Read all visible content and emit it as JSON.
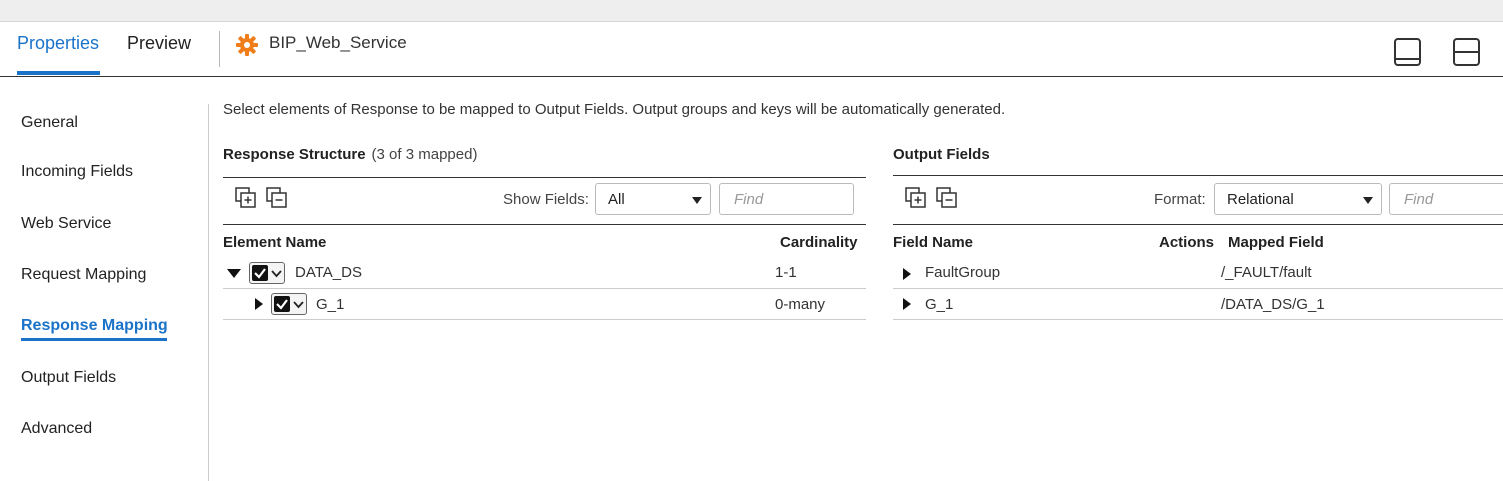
{
  "header": {
    "tabs": [
      {
        "label": "Properties",
        "active": true
      },
      {
        "label": "Preview",
        "active": false
      }
    ],
    "object_title": "BIP_Web_Service",
    "accent_color": "#1a73c9",
    "gear_color": "#f07d1a"
  },
  "nav": {
    "items": [
      {
        "label": "General",
        "active": false
      },
      {
        "label": "Incoming Fields",
        "active": false
      },
      {
        "label": "Web Service",
        "active": false
      },
      {
        "label": "Request Mapping",
        "active": false
      },
      {
        "label": "Response Mapping",
        "active": true
      },
      {
        "label": "Output Fields",
        "active": false
      },
      {
        "label": "Advanced",
        "active": false
      }
    ]
  },
  "description": "Select elements of Response to be mapped to Output Fields. Output groups and keys will be automatically generated.",
  "response": {
    "title": "Response Structure",
    "mapped_status": "(3 of 3 mapped)",
    "show_fields_label": "Show Fields:",
    "show_fields_value": "All",
    "find_placeholder": "Find",
    "columns": {
      "element": "Element Name",
      "cardinality": "Cardinality"
    },
    "rows": [
      {
        "name": "DATA_DS",
        "cardinality": "1-1",
        "expanded": true,
        "checked": true
      },
      {
        "name": "G_1",
        "cardinality": "0-many",
        "expanded": false,
        "checked": true
      }
    ]
  },
  "output": {
    "title": "Output Fields",
    "format_label": "Format:",
    "format_value": "Relational",
    "find_placeholder": "Find",
    "columns": {
      "field": "Field Name",
      "actions": "Actions",
      "mapped": "Mapped Field"
    },
    "rows": [
      {
        "name": "FaultGroup",
        "mapped": "/_FAULT/fault"
      },
      {
        "name": "G_1",
        "mapped": "/DATA_DS/G_1"
      }
    ]
  }
}
